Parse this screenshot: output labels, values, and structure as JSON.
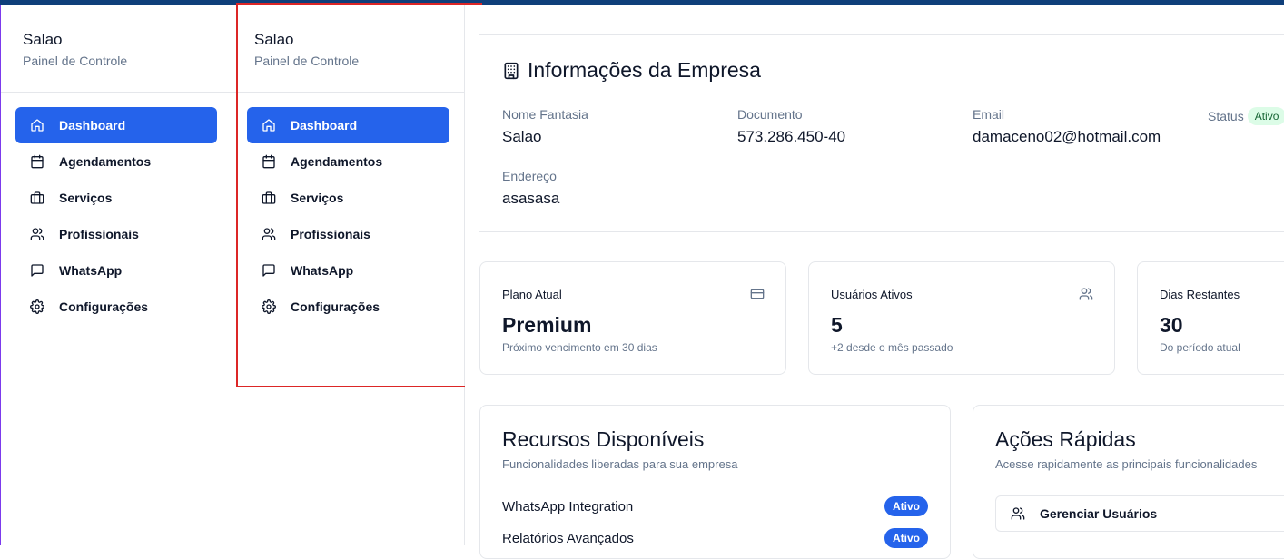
{
  "sidebar": {
    "title": "Salao",
    "subtitle": "Painel de Controle",
    "items": [
      {
        "label": "Dashboard",
        "icon": "home-icon",
        "active": true
      },
      {
        "label": "Agendamentos",
        "icon": "calendar-icon"
      },
      {
        "label": "Serviços",
        "icon": "briefcase-icon"
      },
      {
        "label": "Profissionais",
        "icon": "users-icon"
      },
      {
        "label": "WhatsApp",
        "icon": "message-icon"
      },
      {
        "label": "Configurações",
        "icon": "gear-icon"
      }
    ]
  },
  "company": {
    "title": "Informações da Empresa",
    "icon": "building-icon",
    "fields": {
      "name_label": "Nome Fantasia",
      "name_value": "Salao",
      "doc_label": "Documento",
      "doc_value": "573.286.450-40",
      "email_label": "Email",
      "email_value": "damaceno02@hotmail.com",
      "address_label": "Endereço",
      "address_value": "asasasa",
      "status_label": "Status",
      "status_value": "Ativo"
    }
  },
  "stats": [
    {
      "title": "Plano Atual",
      "value": "Premium",
      "sub": "Próximo vencimento em 30 dias",
      "icon": "credit-card-icon"
    },
    {
      "title": "Usuários Ativos",
      "value": "5",
      "sub": "+2 desde o mês passado",
      "icon": "users-icon"
    },
    {
      "title": "Dias Restantes",
      "value": "30",
      "sub": "Do período atual",
      "icon": "clock-icon"
    }
  ],
  "resources": {
    "title": "Recursos Disponíveis",
    "subtitle": "Funcionalidades liberadas para sua empresa",
    "items": [
      {
        "label": "WhatsApp Integration",
        "status": "Ativo"
      },
      {
        "label": "Relatórios Avançados",
        "status": "Ativo"
      }
    ]
  },
  "quick_actions": {
    "title": "Ações Rápidas",
    "subtitle": "Acesse rapidamente as principais funcionalidades",
    "items": [
      {
        "label": "Gerenciar Usuários",
        "icon": "users-icon"
      }
    ]
  },
  "colors": {
    "accent": "#2563eb",
    "topbar": "#0f3f7a",
    "highlight": "#dc2626",
    "success_bg": "#dcfce7"
  }
}
